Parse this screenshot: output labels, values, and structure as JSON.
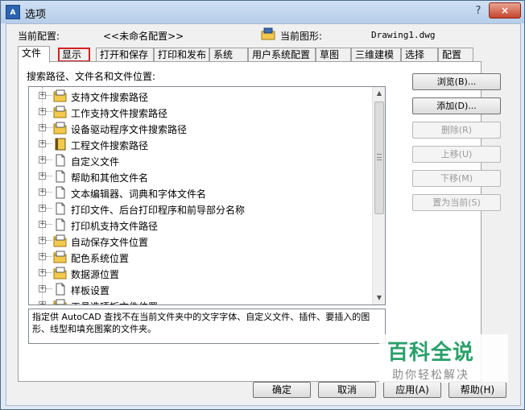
{
  "window": {
    "title": "选项",
    "app_icon_text": "A",
    "help_icon": "?",
    "close_icon": "×"
  },
  "header": {
    "profile_label": "当前配置:",
    "profile_value": "<<未命名配置>>",
    "drawing_label": "当前图形:",
    "drawing_value": "Drawing1.dwg"
  },
  "tabs": [
    {
      "label": "文件",
      "active": true
    },
    {
      "label": "显示",
      "highlighted": true
    },
    {
      "label": "打开和保存"
    },
    {
      "label": "打印和发布"
    },
    {
      "label": "系统"
    },
    {
      "label": "用户系统配置"
    },
    {
      "label": "草图"
    },
    {
      "label": "三维建模"
    },
    {
      "label": "选择"
    },
    {
      "label": "配置"
    }
  ],
  "panel": {
    "label": "搜索路径、文件名和文件位置:",
    "tree_items": [
      {
        "label": "支持文件搜索路径",
        "icon": "folder-stack-icon"
      },
      {
        "label": "工作支持文件搜索路径",
        "icon": "folder-stack-icon"
      },
      {
        "label": "设备驱动程序文件搜索路径",
        "icon": "folder-stack-icon"
      },
      {
        "label": "工程文件搜索路径",
        "icon": "book-icon"
      },
      {
        "label": "自定义文件",
        "icon": "document-icon"
      },
      {
        "label": "帮助和其他文件名",
        "icon": "document-icon"
      },
      {
        "label": "文本编辑器、词典和字体文件名",
        "icon": "document-icon"
      },
      {
        "label": "打印文件、后台打印程序和前导部分名称",
        "icon": "document-icon"
      },
      {
        "label": "打印机支持文件路径",
        "icon": "document-icon"
      },
      {
        "label": "自动保存文件位置",
        "icon": "folder-stack-icon"
      },
      {
        "label": "配色系统位置",
        "icon": "folder-stack-icon"
      },
      {
        "label": "数据源位置",
        "icon": "folder-stack-icon"
      },
      {
        "label": "样板设置",
        "icon": "document-icon"
      },
      {
        "label": "工具选项板文件位置",
        "icon": "folder-stack-icon"
      }
    ],
    "description": "指定供 AutoCAD 查找不在当前文件夹中的文字字体、自定义文件、插件、要插入的图形、线型和填充图案的文件夹。"
  },
  "side_buttons": [
    {
      "label": "浏览(B)...",
      "enabled": true
    },
    {
      "label": "添加(D)...",
      "enabled": true
    },
    {
      "label": "删除(R)",
      "enabled": false
    },
    {
      "label": "上移(U)",
      "enabled": false
    },
    {
      "label": "下移(M)",
      "enabled": false
    },
    {
      "label": "置为当前(S)",
      "enabled": false
    }
  ],
  "bottom_buttons": {
    "ok": "确定",
    "cancel": "取消",
    "apply": "应用(A)",
    "help": "帮助(H)"
  },
  "watermark": {
    "title": "百科全说",
    "subtitle": "助你轻松解决"
  },
  "colors": {
    "tab_highlight": "#d42020",
    "watermark_green": "#2aa06a",
    "folder_yellow": "#f2c94c"
  }
}
